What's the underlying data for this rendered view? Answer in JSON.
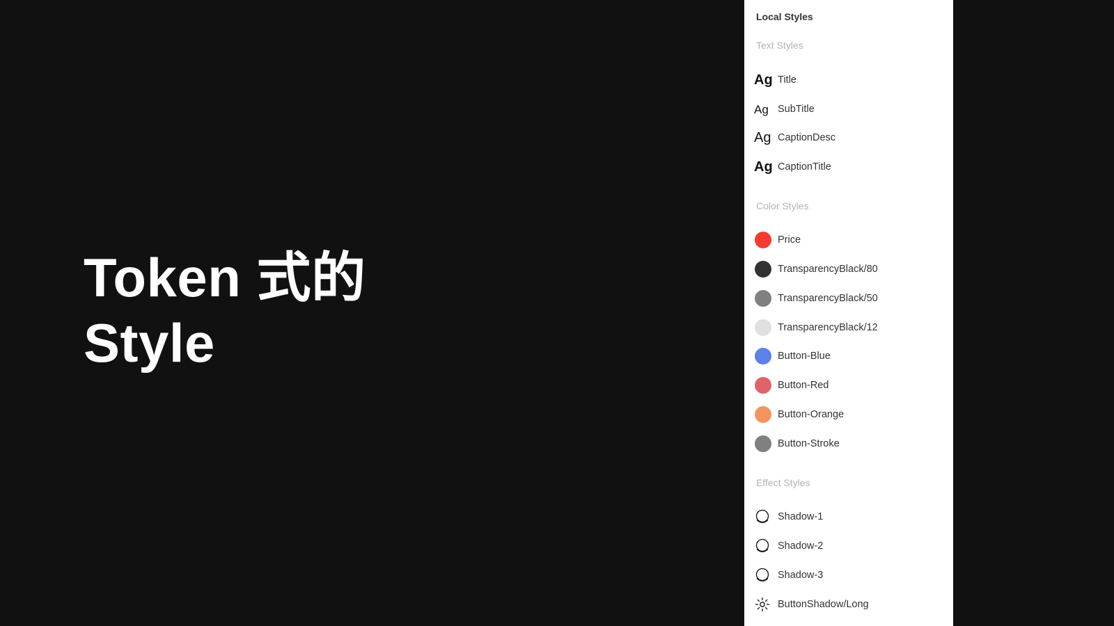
{
  "hero": {
    "line1": "Token 式的",
    "line2": "Style"
  },
  "panel": {
    "title": "Local Styles",
    "text_section": {
      "heading": "Text Styles",
      "items": [
        {
          "icon": "Ag",
          "label": "Title"
        },
        {
          "icon": "Ag",
          "label": "SubTitle"
        },
        {
          "icon": "Ag",
          "label": "CaptionDesc"
        },
        {
          "icon": "Ag",
          "label": "CaptionTitle"
        }
      ]
    },
    "color_section": {
      "heading": "Color Styles",
      "items": [
        {
          "label": "Price",
          "color": "#f53a2f"
        },
        {
          "label": "TransparencyBlack/80",
          "color": "#333333"
        },
        {
          "label": "TransparencyBlack/50",
          "color": "#808080"
        },
        {
          "label": "TransparencyBlack/12",
          "color": "#e0e0e0"
        },
        {
          "label": "Button-Blue",
          "color": "#5b82e8"
        },
        {
          "label": "Button-Red",
          "color": "#e0636a"
        },
        {
          "label": "Button-Orange",
          "color": "#f2945e"
        },
        {
          "label": "Button-Stroke",
          "color": "#808080"
        }
      ]
    },
    "effect_section": {
      "heading": "Effect Styles",
      "items": [
        {
          "label": "Shadow-1",
          "icon": "drop-shadow-icon"
        },
        {
          "label": "Shadow-2",
          "icon": "drop-shadow-icon"
        },
        {
          "label": "Shadow-3",
          "icon": "drop-shadow-icon"
        },
        {
          "label": "ButtonShadow/Long",
          "icon": "sun-icon"
        }
      ]
    }
  }
}
